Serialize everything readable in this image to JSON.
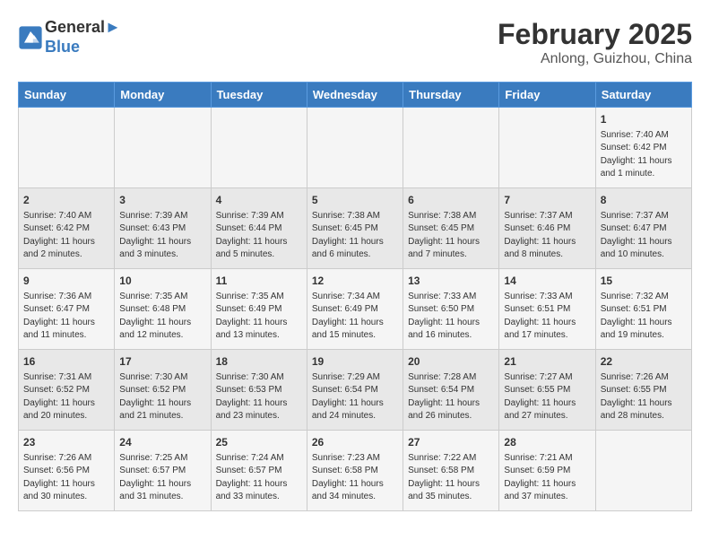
{
  "header": {
    "logo_line1": "General",
    "logo_line2": "Blue",
    "month_year": "February 2025",
    "location": "Anlong, Guizhou, China"
  },
  "days_of_week": [
    "Sunday",
    "Monday",
    "Tuesday",
    "Wednesday",
    "Thursday",
    "Friday",
    "Saturday"
  ],
  "weeks": [
    [
      {
        "day": "",
        "info": ""
      },
      {
        "day": "",
        "info": ""
      },
      {
        "day": "",
        "info": ""
      },
      {
        "day": "",
        "info": ""
      },
      {
        "day": "",
        "info": ""
      },
      {
        "day": "",
        "info": ""
      },
      {
        "day": "1",
        "info": "Sunrise: 7:40 AM\nSunset: 6:42 PM\nDaylight: 11 hours\nand 1 minute."
      }
    ],
    [
      {
        "day": "2",
        "info": "Sunrise: 7:40 AM\nSunset: 6:42 PM\nDaylight: 11 hours\nand 2 minutes."
      },
      {
        "day": "3",
        "info": "Sunrise: 7:39 AM\nSunset: 6:43 PM\nDaylight: 11 hours\nand 3 minutes."
      },
      {
        "day": "4",
        "info": "Sunrise: 7:39 AM\nSunset: 6:44 PM\nDaylight: 11 hours\nand 5 minutes."
      },
      {
        "day": "5",
        "info": "Sunrise: 7:38 AM\nSunset: 6:45 PM\nDaylight: 11 hours\nand 6 minutes."
      },
      {
        "day": "6",
        "info": "Sunrise: 7:38 AM\nSunset: 6:45 PM\nDaylight: 11 hours\nand 7 minutes."
      },
      {
        "day": "7",
        "info": "Sunrise: 7:37 AM\nSunset: 6:46 PM\nDaylight: 11 hours\nand 8 minutes."
      },
      {
        "day": "8",
        "info": "Sunrise: 7:37 AM\nSunset: 6:47 PM\nDaylight: 11 hours\nand 10 minutes."
      }
    ],
    [
      {
        "day": "9",
        "info": "Sunrise: 7:36 AM\nSunset: 6:47 PM\nDaylight: 11 hours\nand 11 minutes."
      },
      {
        "day": "10",
        "info": "Sunrise: 7:35 AM\nSunset: 6:48 PM\nDaylight: 11 hours\nand 12 minutes."
      },
      {
        "day": "11",
        "info": "Sunrise: 7:35 AM\nSunset: 6:49 PM\nDaylight: 11 hours\nand 13 minutes."
      },
      {
        "day": "12",
        "info": "Sunrise: 7:34 AM\nSunset: 6:49 PM\nDaylight: 11 hours\nand 15 minutes."
      },
      {
        "day": "13",
        "info": "Sunrise: 7:33 AM\nSunset: 6:50 PM\nDaylight: 11 hours\nand 16 minutes."
      },
      {
        "day": "14",
        "info": "Sunrise: 7:33 AM\nSunset: 6:51 PM\nDaylight: 11 hours\nand 17 minutes."
      },
      {
        "day": "15",
        "info": "Sunrise: 7:32 AM\nSunset: 6:51 PM\nDaylight: 11 hours\nand 19 minutes."
      }
    ],
    [
      {
        "day": "16",
        "info": "Sunrise: 7:31 AM\nSunset: 6:52 PM\nDaylight: 11 hours\nand 20 minutes."
      },
      {
        "day": "17",
        "info": "Sunrise: 7:30 AM\nSunset: 6:52 PM\nDaylight: 11 hours\nand 21 minutes."
      },
      {
        "day": "18",
        "info": "Sunrise: 7:30 AM\nSunset: 6:53 PM\nDaylight: 11 hours\nand 23 minutes."
      },
      {
        "day": "19",
        "info": "Sunrise: 7:29 AM\nSunset: 6:54 PM\nDaylight: 11 hours\nand 24 minutes."
      },
      {
        "day": "20",
        "info": "Sunrise: 7:28 AM\nSunset: 6:54 PM\nDaylight: 11 hours\nand 26 minutes."
      },
      {
        "day": "21",
        "info": "Sunrise: 7:27 AM\nSunset: 6:55 PM\nDaylight: 11 hours\nand 27 minutes."
      },
      {
        "day": "22",
        "info": "Sunrise: 7:26 AM\nSunset: 6:55 PM\nDaylight: 11 hours\nand 28 minutes."
      }
    ],
    [
      {
        "day": "23",
        "info": "Sunrise: 7:26 AM\nSunset: 6:56 PM\nDaylight: 11 hours\nand 30 minutes."
      },
      {
        "day": "24",
        "info": "Sunrise: 7:25 AM\nSunset: 6:57 PM\nDaylight: 11 hours\nand 31 minutes."
      },
      {
        "day": "25",
        "info": "Sunrise: 7:24 AM\nSunset: 6:57 PM\nDaylight: 11 hours\nand 33 minutes."
      },
      {
        "day": "26",
        "info": "Sunrise: 7:23 AM\nSunset: 6:58 PM\nDaylight: 11 hours\nand 34 minutes."
      },
      {
        "day": "27",
        "info": "Sunrise: 7:22 AM\nSunset: 6:58 PM\nDaylight: 11 hours\nand 35 minutes."
      },
      {
        "day": "28",
        "info": "Sunrise: 7:21 AM\nSunset: 6:59 PM\nDaylight: 11 hours\nand 37 minutes."
      },
      {
        "day": "",
        "info": ""
      }
    ]
  ]
}
